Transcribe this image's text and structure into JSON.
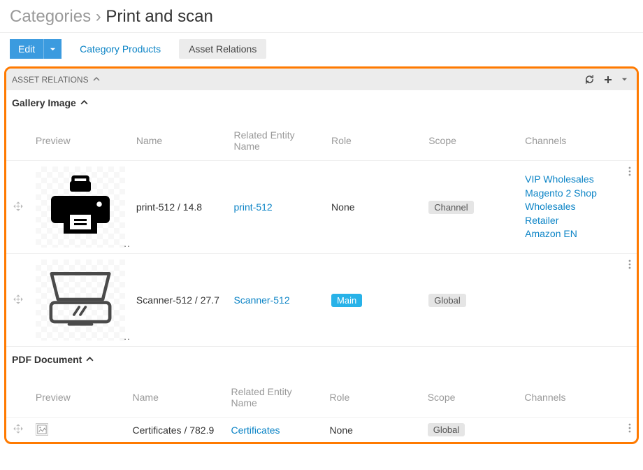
{
  "breadcrumb": {
    "root": "Categories",
    "sep": "›",
    "current": "Print and scan"
  },
  "toolbar": {
    "edit_label": "Edit",
    "tab_products": "Category Products",
    "tab_relations": "Asset Relations"
  },
  "panel": {
    "title": "ASSET RELATIONS"
  },
  "columns": {
    "preview": "Preview",
    "name": "Name",
    "related": "Related Entity Name",
    "role": "Role",
    "scope": "Scope",
    "channels": "Channels"
  },
  "sections": {
    "gallery": {
      "title": "Gallery Image"
    },
    "pdf": {
      "title": "PDF Document"
    }
  },
  "rows": {
    "r0": {
      "name": "print-512 / 14.8",
      "related": "print-512",
      "role": "None",
      "scope": "Channel",
      "channels": [
        "VIP Wholesales",
        "Magento 2 Shop",
        "Wholesales",
        "Retailer",
        "Amazon EN"
      ]
    },
    "r1": {
      "name": "Scanner-512 / 27.7",
      "related": "Scanner-512",
      "role": "Main",
      "scope": "Global",
      "channels": []
    },
    "r2": {
      "name": "Certificates / 782.9",
      "related": "Certificates",
      "role": "None",
      "scope": "Global",
      "channels": []
    }
  }
}
